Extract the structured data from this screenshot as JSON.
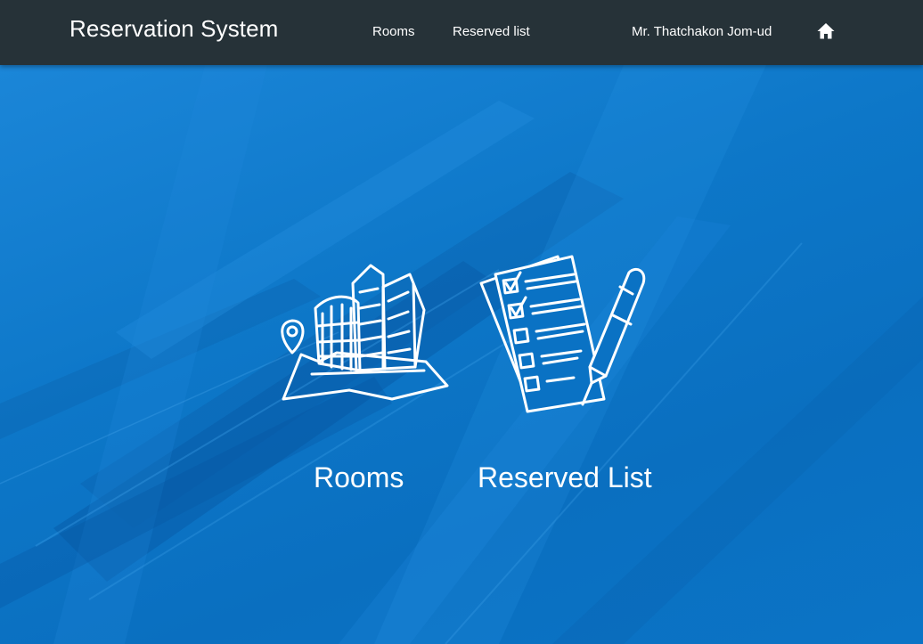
{
  "navbar": {
    "brand": "Reservation System",
    "links": [
      {
        "label": "Rooms"
      },
      {
        "label": "Reserved list"
      }
    ],
    "user_name": "Mr. Thatchakon Jom-ud",
    "home_icon": "home-icon"
  },
  "menu": {
    "rooms": {
      "label": "Rooms",
      "icon": "building-map-icon"
    },
    "reserved": {
      "label": "Reserved List",
      "icon": "checklist-pen-icon"
    }
  },
  "colors": {
    "navbar_bg": "#263238",
    "hero_bg": "#0a72c4",
    "text": "#ffffff"
  }
}
